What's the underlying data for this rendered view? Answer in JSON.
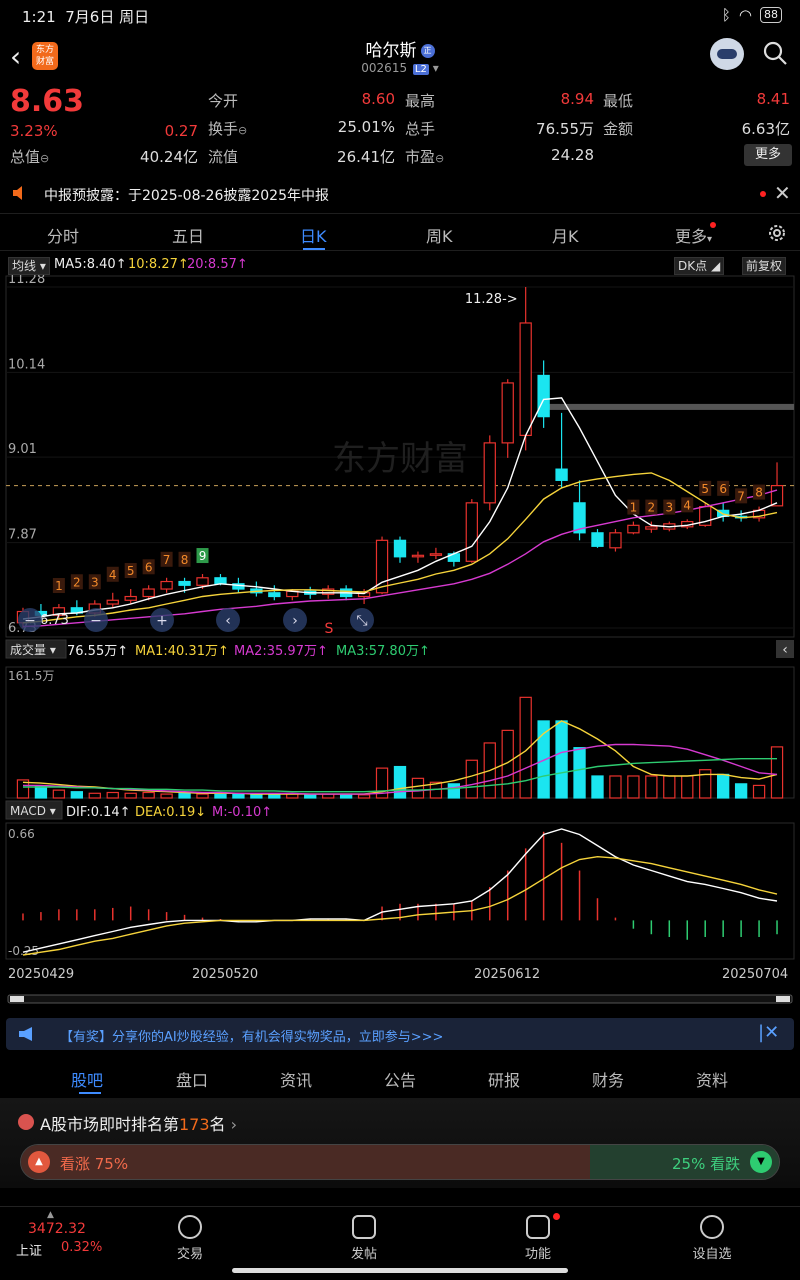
{
  "status": {
    "time": "1:21",
    "date": "7月6日 周日",
    "battery": "88"
  },
  "header": {
    "name": "哈尔斯",
    "badge": "正",
    "code": "002615",
    "level": "L2",
    "logo_line1": "东方",
    "logo_line2": "财富"
  },
  "quote": {
    "price": "8.63",
    "pct": "3.23%",
    "change": "0.27",
    "cells": [
      {
        "label": "今开",
        "value": "8.60",
        "color": "red"
      },
      {
        "label": "最高",
        "value": "8.94",
        "color": "red"
      },
      {
        "label": "最低",
        "value": "8.41",
        "color": "red"
      },
      {
        "label": "换手",
        "value": "25.01%",
        "color": "white"
      },
      {
        "label": "总手",
        "value": "76.55万",
        "color": "white"
      },
      {
        "label": "金额",
        "value": "6.63亿",
        "color": "white"
      },
      {
        "label": "总值",
        "value": "40.24亿",
        "color": "white"
      },
      {
        "label": "流值",
        "value": "26.41亿",
        "color": "white"
      },
      {
        "label": "市盈",
        "value": "24.28",
        "color": "white"
      }
    ],
    "more": "更多"
  },
  "notice": {
    "text": "中报预披露：于2025-08-26披露2025年中报"
  },
  "tabs": [
    "分时",
    "五日",
    "日K",
    "周K",
    "月K",
    "更多"
  ],
  "ma_row": {
    "tag": "均线",
    "ma5": "MA5:8.40",
    "ma10": "10:8.27",
    "ma20": "20:8.57",
    "dk": "DK点",
    "fq": "前复权"
  },
  "vol_row": {
    "tag": "成交量",
    "v": "76.55万",
    "ma1": "MA1:40.31万",
    "ma2": "MA2:35.97万",
    "ma3": "MA3:57.80万",
    "vmax": "161.5万"
  },
  "macd_row": {
    "tag": "MACD",
    "dif": "DIF:0.14",
    "dea": "DEA:0.19",
    "m": "M:-0.10",
    "top": "0.66",
    "bottom": "-0.25"
  },
  "chart_data": {
    "type": "candlestick",
    "y_ticks": [
      "11.28",
      "10.14",
      "9.01",
      "7.87",
      "6.73"
    ],
    "ylim": [
      6.73,
      11.28
    ],
    "high_label": "11.28->",
    "low_label": "6.73",
    "dates": [
      "20250429",
      "20250520",
      "20250612",
      "20250704"
    ],
    "seq_top": [
      "1",
      "2",
      "3",
      "4",
      "5",
      "6",
      "7",
      "8",
      "9"
    ],
    "seq_bottom": [
      "1",
      "2",
      "3",
      "4",
      "5",
      "6",
      "7",
      "8"
    ],
    "s_label": "S",
    "candles": [
      {
        "o": 6.8,
        "h": 7.0,
        "l": 6.73,
        "c": 6.95
      },
      {
        "o": 6.95,
        "h": 7.05,
        "l": 6.85,
        "c": 6.9
      },
      {
        "o": 6.9,
        "h": 7.05,
        "l": 6.85,
        "c": 7.0
      },
      {
        "o": 7.0,
        "h": 7.1,
        "l": 6.9,
        "c": 6.93
      },
      {
        "o": 6.93,
        "h": 7.1,
        "l": 6.88,
        "c": 7.05
      },
      {
        "o": 7.05,
        "h": 7.2,
        "l": 7.0,
        "c": 7.1
      },
      {
        "o": 7.1,
        "h": 7.25,
        "l": 7.05,
        "c": 7.15
      },
      {
        "o": 7.15,
        "h": 7.3,
        "l": 7.1,
        "c": 7.25
      },
      {
        "o": 7.25,
        "h": 7.4,
        "l": 7.2,
        "c": 7.35
      },
      {
        "o": 7.35,
        "h": 7.4,
        "l": 7.2,
        "c": 7.3
      },
      {
        "o": 7.3,
        "h": 7.45,
        "l": 7.25,
        "c": 7.4
      },
      {
        "o": 7.4,
        "h": 7.45,
        "l": 7.3,
        "c": 7.32
      },
      {
        "o": 7.32,
        "h": 7.4,
        "l": 7.2,
        "c": 7.25
      },
      {
        "o": 7.25,
        "h": 7.35,
        "l": 7.15,
        "c": 7.2
      },
      {
        "o": 7.2,
        "h": 7.3,
        "l": 7.1,
        "c": 7.15
      },
      {
        "o": 7.15,
        "h": 7.25,
        "l": 7.1,
        "c": 7.22
      },
      {
        "o": 7.22,
        "h": 7.28,
        "l": 7.12,
        "c": 7.18
      },
      {
        "o": 7.18,
        "h": 7.3,
        "l": 7.12,
        "c": 7.25
      },
      {
        "o": 7.25,
        "h": 7.3,
        "l": 7.1,
        "c": 7.15
      },
      {
        "o": 7.15,
        "h": 7.25,
        "l": 7.05,
        "c": 7.2
      },
      {
        "o": 7.2,
        "h": 7.95,
        "l": 7.18,
        "c": 7.9
      },
      {
        "o": 7.9,
        "h": 7.95,
        "l": 7.6,
        "c": 7.68
      },
      {
        "o": 7.68,
        "h": 7.75,
        "l": 7.6,
        "c": 7.7
      },
      {
        "o": 7.7,
        "h": 7.8,
        "l": 7.65,
        "c": 7.72
      },
      {
        "o": 7.72,
        "h": 7.75,
        "l": 7.55,
        "c": 7.62
      },
      {
        "o": 7.62,
        "h": 8.45,
        "l": 7.6,
        "c": 8.4
      },
      {
        "o": 8.4,
        "h": 9.3,
        "l": 8.3,
        "c": 9.2
      },
      {
        "o": 9.2,
        "h": 10.05,
        "l": 9.0,
        "c": 10.0
      },
      {
        "o": 9.3,
        "h": 11.28,
        "l": 9.1,
        "c": 10.8
      },
      {
        "o": 10.1,
        "h": 10.3,
        "l": 9.4,
        "c": 9.55
      },
      {
        "o": 8.85,
        "h": 9.6,
        "l": 8.6,
        "c": 8.7
      },
      {
        "o": 8.4,
        "h": 8.7,
        "l": 7.9,
        "c": 8.0
      },
      {
        "o": 8.0,
        "h": 8.05,
        "l": 7.8,
        "c": 7.82
      },
      {
        "o": 7.8,
        "h": 8.05,
        "l": 7.75,
        "c": 8.0
      },
      {
        "o": 8.0,
        "h": 8.15,
        "l": 7.98,
        "c": 8.1
      },
      {
        "o": 8.05,
        "h": 8.15,
        "l": 8.0,
        "c": 8.08
      },
      {
        "o": 8.05,
        "h": 8.15,
        "l": 8.02,
        "c": 8.12
      },
      {
        "o": 8.08,
        "h": 8.18,
        "l": 8.05,
        "c": 8.15
      },
      {
        "o": 8.1,
        "h": 8.4,
        "l": 8.08,
        "c": 8.35
      },
      {
        "o": 8.3,
        "h": 8.4,
        "l": 8.15,
        "c": 8.22
      },
      {
        "o": 8.22,
        "h": 8.3,
        "l": 8.15,
        "c": 8.2
      },
      {
        "o": 8.2,
        "h": 8.35,
        "l": 8.15,
        "c": 8.3
      },
      {
        "o": 8.36,
        "h": 8.94,
        "l": 8.41,
        "c": 8.63
      }
    ],
    "ma5": [
      6.85,
      6.88,
      6.92,
      6.93,
      6.97,
      7.0,
      7.05,
      7.12,
      7.18,
      7.23,
      7.28,
      7.32,
      7.3,
      7.28,
      7.25,
      7.22,
      7.2,
      7.2,
      7.2,
      7.19,
      7.34,
      7.42,
      7.5,
      7.62,
      7.72,
      7.82,
      8.15,
      8.6,
      9.3,
      9.78,
      9.8,
      9.4,
      8.95,
      8.5,
      8.25,
      8.1,
      8.08,
      8.1,
      8.15,
      8.22,
      8.25,
      8.3,
      8.4
    ],
    "ma10": [
      6.8,
      6.82,
      6.85,
      6.88,
      6.9,
      6.93,
      6.97,
      7.0,
      7.05,
      7.1,
      7.15,
      7.18,
      7.2,
      7.22,
      7.23,
      7.24,
      7.24,
      7.23,
      7.22,
      7.21,
      7.28,
      7.33,
      7.38,
      7.45,
      7.5,
      7.58,
      7.72,
      7.92,
      8.18,
      8.45,
      8.6,
      8.68,
      8.72,
      8.75,
      8.78,
      8.8,
      8.7,
      8.55,
      8.4,
      8.25,
      8.2,
      8.22,
      8.27
    ],
    "ma20": [
      6.75,
      6.76,
      6.78,
      6.8,
      6.82,
      6.84,
      6.86,
      6.88,
      6.9,
      6.92,
      6.95,
      6.98,
      7.0,
      7.02,
      7.05,
      7.07,
      7.09,
      7.1,
      7.11,
      7.12,
      7.16,
      7.2,
      7.24,
      7.28,
      7.32,
      7.38,
      7.46,
      7.58,
      7.72,
      7.88,
      7.98,
      8.05,
      8.1,
      8.15,
      8.2,
      8.23,
      8.26,
      8.3,
      8.35,
      8.4,
      8.45,
      8.5,
      8.57
    ],
    "volume": [
      23,
      15,
      10,
      8,
      6,
      7,
      6,
      7,
      5,
      6,
      5,
      5,
      5,
      4,
      4,
      5,
      4,
      5,
      5,
      4,
      38,
      40,
      25,
      20,
      18,
      48,
      70,
      86,
      128,
      98,
      98,
      64,
      28,
      28,
      28,
      28,
      28,
      28,
      36,
      30,
      18,
      16,
      65
    ],
    "vol_ma1": [
      20,
      19,
      17,
      15,
      14,
      12,
      10,
      9,
      8,
      7,
      6,
      6,
      6,
      5,
      5,
      5,
      5,
      5,
      5,
      5,
      8,
      12,
      15,
      18,
      22,
      28,
      35,
      45,
      60,
      82,
      98,
      88,
      75,
      60,
      40,
      30,
      28,
      28,
      30,
      30,
      26,
      24,
      30
    ],
    "vol_ma2": [
      16,
      16,
      15,
      14,
      13,
      12,
      11,
      10,
      9,
      8,
      7,
      7,
      6,
      6,
      6,
      6,
      5,
      5,
      5,
      5,
      6,
      8,
      9,
      11,
      13,
      17,
      22,
      28,
      38,
      48,
      58,
      62,
      66,
      68,
      68,
      67,
      66,
      62,
      55,
      48,
      40,
      32,
      30
    ],
    "vol_ma3": [
      14,
      14,
      14,
      13,
      13,
      12,
      12,
      11,
      11,
      10,
      10,
      9,
      9,
      9,
      9,
      8,
      8,
      8,
      8,
      8,
      9,
      10,
      10,
      11,
      12,
      14,
      16,
      18,
      22,
      28,
      32,
      36,
      40,
      42,
      44,
      45,
      46,
      47,
      48,
      49,
      50,
      50,
      50
    ],
    "macd_dif": [
      -0.23,
      -0.2,
      -0.17,
      -0.14,
      -0.11,
      -0.08,
      -0.05,
      -0.03,
      -0.01,
      0.0,
      0.0,
      0.0,
      -0.01,
      -0.01,
      0.0,
      0.0,
      0.01,
      0.01,
      0.01,
      0.0,
      0.06,
      0.08,
      0.1,
      0.11,
      0.12,
      0.14,
      0.22,
      0.33,
      0.48,
      0.62,
      0.66,
      0.62,
      0.54,
      0.46,
      0.4,
      0.36,
      0.32,
      0.28,
      0.26,
      0.23,
      0.2,
      0.16,
      0.14
    ],
    "macd_dea": [
      -0.25,
      -0.23,
      -0.21,
      -0.18,
      -0.15,
      -0.13,
      -0.1,
      -0.07,
      -0.04,
      -0.02,
      -0.01,
      0.0,
      0.0,
      0.0,
      0.0,
      0.0,
      0.0,
      0.0,
      0.0,
      0.0,
      0.01,
      0.02,
      0.04,
      0.05,
      0.06,
      0.07,
      0.1,
      0.15,
      0.22,
      0.3,
      0.38,
      0.44,
      0.46,
      0.45,
      0.43,
      0.41,
      0.38,
      0.35,
      0.32,
      0.29,
      0.26,
      0.22,
      0.19
    ],
    "macd_m": [
      0.05,
      0.06,
      0.08,
      0.08,
      0.08,
      0.09,
      0.1,
      0.08,
      0.06,
      0.04,
      0.02,
      0.01,
      -0.01,
      -0.01,
      0.0,
      0.0,
      0.01,
      0.01,
      0.01,
      0.0,
      0.1,
      0.12,
      0.12,
      0.12,
      0.12,
      0.14,
      0.24,
      0.36,
      0.52,
      0.64,
      0.56,
      0.36,
      0.16,
      0.02,
      -0.06,
      -0.1,
      -0.12,
      -0.14,
      -0.12,
      -0.12,
      -0.12,
      -0.12,
      -0.1
    ]
  },
  "promo": {
    "text": "【有奖】分享你的AI炒股经验，有机会得实物奖品，立即参与>>>"
  },
  "bottom_tabs": [
    "股吧",
    "盘口",
    "资讯",
    "公告",
    "研报",
    "财务",
    "资料"
  ],
  "rank": {
    "prefix": "A股市场即时排名第",
    "num": "173",
    "suffix": "名",
    "up": "看涨 75%",
    "down": "25% 看跌",
    "up_pct": 75
  },
  "index": {
    "value": "3472.32",
    "name": "上证",
    "pct": "0.32%"
  },
  "nav": [
    "交易",
    "发帖",
    "功能",
    "设自选"
  ]
}
